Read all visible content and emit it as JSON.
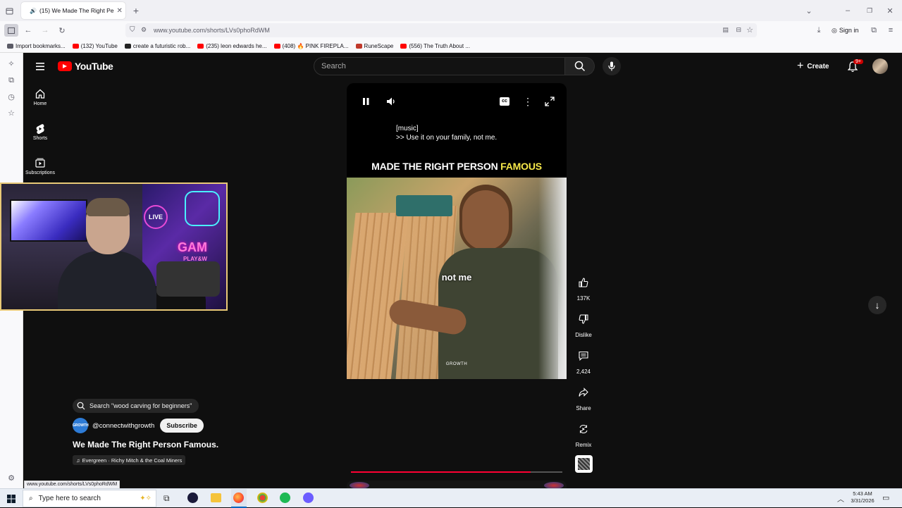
{
  "browser": {
    "tab_title": "(15) We Made The Right Pe",
    "url": "www.youtube.com/shorts/LVs0phoRdWM",
    "sign_in": "Sign in",
    "status_url": "www.youtube.com/shorts/LVs0phoRdWM",
    "bookmarks": [
      {
        "label": "Import bookmarks...",
        "color": "#5b5b66"
      },
      {
        "label": "(132) YouTube",
        "color": "#ff0000"
      },
      {
        "label": "create a futuristic rob...",
        "color": "#222222"
      },
      {
        "label": "(235) leon edwards he...",
        "color": "#ff0000"
      },
      {
        "label": "(408) 🔥 PINK FIREPLA...",
        "color": "#ff0000"
      },
      {
        "label": "RuneScape",
        "color": "#c0392b"
      },
      {
        "label": "(556) The Truth About ...",
        "color": "#ff0000"
      }
    ]
  },
  "youtube": {
    "logo_text": "YouTube",
    "search_placeholder": "Search",
    "create_label": "Create",
    "notif_count": "9+",
    "nav": [
      {
        "label": "Home",
        "icon": "home-icon"
      },
      {
        "label": "Shorts",
        "icon": "shorts-icon"
      },
      {
        "label": "Subscriptions",
        "icon": "subscriptions-icon"
      }
    ]
  },
  "video": {
    "caption_line1": "[music]",
    "caption_line2": ">> Use it on your family, not me.",
    "tagline_main": "MADE THE RIGHT PERSON ",
    "tagline_highlight": "FAMOUS",
    "overlay_subtitle": "not me",
    "watermark": "GROWTH",
    "progress": 0.85
  },
  "actions": {
    "like_count": "137K",
    "dislike_label": "Dislike",
    "comment_count": "2,424",
    "share_label": "Share",
    "remix_label": "Remix"
  },
  "short_info": {
    "search_suggestion": "Search \"wood carving for beginners\"",
    "channel": "@connectwithgrowth",
    "subscribe_label": "Subscribe",
    "title": "We Made The Right Person Famous.",
    "sound": "Evergreen · Richy Mitch & the Coal Miners"
  },
  "webcam": {
    "sign_live": "LIVE",
    "sign_game": "GAM",
    "sign_play": "PLAY&W"
  },
  "taskbar": {
    "search_placeholder": "Type here to search",
    "time": "5:43 AM",
    "date": "3/31/2026"
  }
}
